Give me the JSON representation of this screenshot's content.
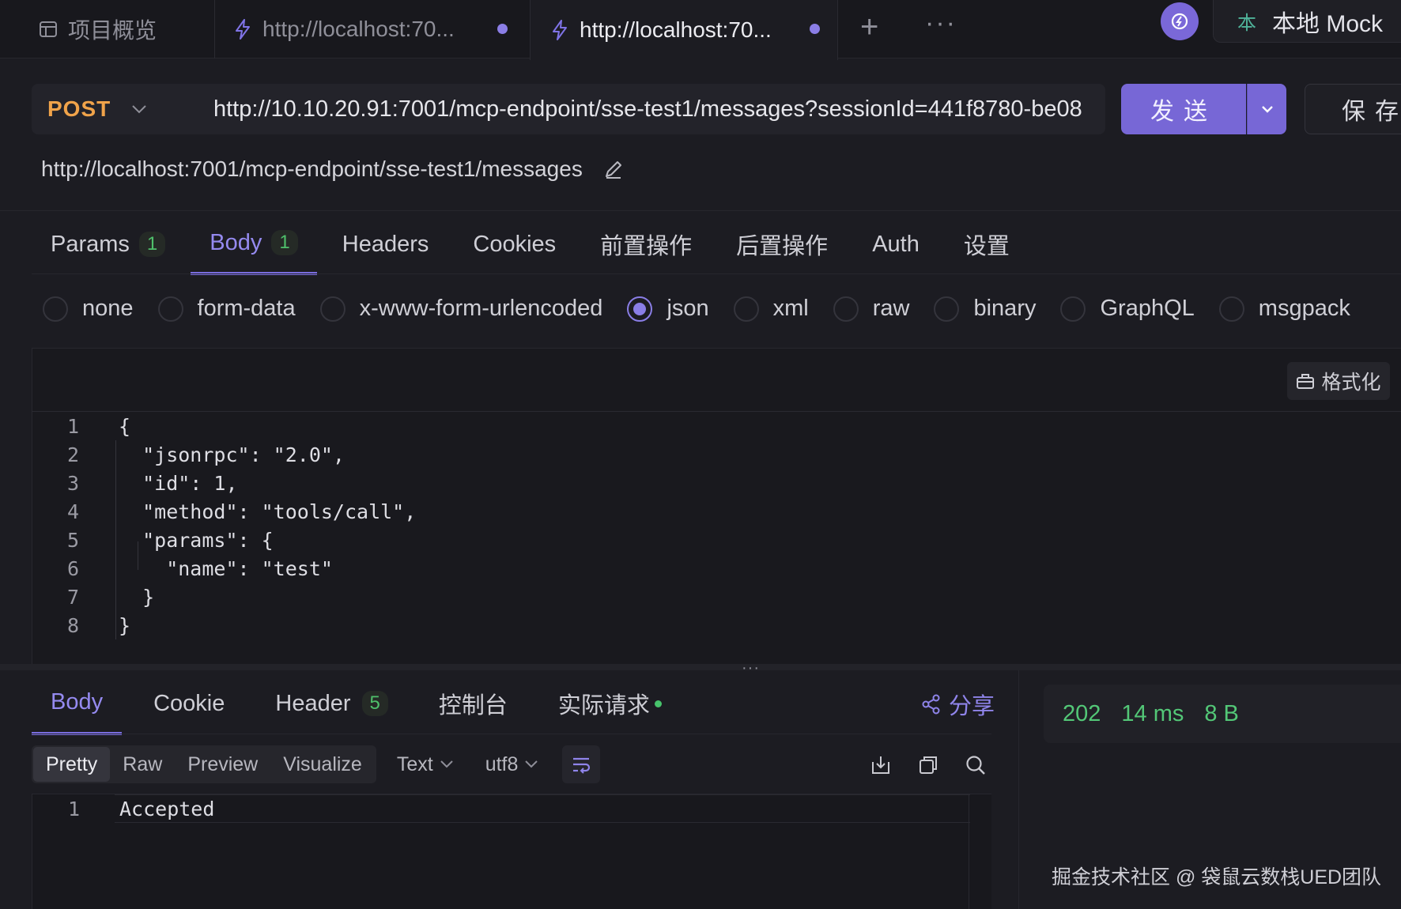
{
  "tabs": {
    "overview": "项目概览",
    "t1": "http://localhost:70...",
    "t2": "http://localhost:70...",
    "env_badge": "本",
    "env_label": "本地 Mock"
  },
  "request": {
    "method": "POST",
    "url": "http://10.10.20.91:7001/mcp-endpoint/sse-test1/messages?sessionId=441f8780-be08",
    "send": "发送",
    "save": "保存",
    "path": "http://localhost:7001/mcp-endpoint/sse-test1/messages"
  },
  "req_tabs": [
    {
      "label": "Params",
      "count": "1"
    },
    {
      "label": "Body",
      "count": "1"
    },
    {
      "label": "Headers"
    },
    {
      "label": "Cookies"
    },
    {
      "label": "前置操作"
    },
    {
      "label": "后置操作"
    },
    {
      "label": "Auth"
    },
    {
      "label": "设置"
    }
  ],
  "active_req_tab": "Body",
  "body_types": [
    "none",
    "form-data",
    "x-www-form-urlencoded",
    "json",
    "xml",
    "raw",
    "binary",
    "GraphQL",
    "msgpack"
  ],
  "selected_body_type": "json",
  "format_label": "格式化",
  "code": {
    "line_numbers": [
      "1",
      "2",
      "3",
      "4",
      "5",
      "6",
      "7",
      "8"
    ],
    "lines": [
      "{",
      "  \"jsonrpc\": \"2.0\",",
      "  \"id\": 1,",
      "  \"method\": \"tools/call\",",
      "  \"params\": {",
      "    \"name\": \"test\"",
      "  }",
      "}"
    ]
  },
  "resp_tabs": [
    {
      "label": "Body"
    },
    {
      "label": "Cookie"
    },
    {
      "label": "Header",
      "count": "5"
    },
    {
      "label": "控制台"
    },
    {
      "label": "实际请求"
    }
  ],
  "share_label": "分享",
  "view_modes": [
    "Pretty",
    "Raw",
    "Preview",
    "Visualize"
  ],
  "selected_view_mode": "Pretty",
  "format_select": "Text",
  "encoding_select": "utf8",
  "response": {
    "line_number": "1",
    "text": "Accepted",
    "status": "202",
    "time": "14 ms",
    "size": "8 B"
  },
  "watermark": "掘金技术社区 @ 袋鼠云数栈UED团队",
  "colors": {
    "accent": "#7767d6",
    "method": "#f0a34a",
    "success": "#53c777"
  }
}
